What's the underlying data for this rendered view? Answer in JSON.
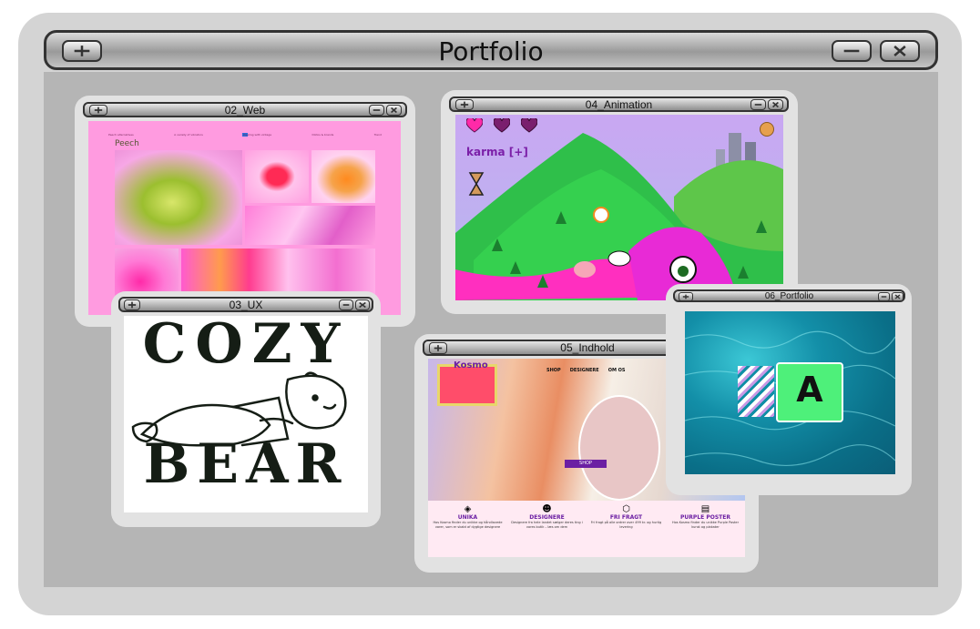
{
  "app": {
    "title": "Portfolio"
  },
  "windows": {
    "web": {
      "title": "02_Web",
      "brand": "Peech",
      "nav": [
        "Peech alternatives",
        "A variety of vibrators",
        "Healing with vintage",
        "Dildos &  brands",
        "Trend"
      ]
    },
    "animation": {
      "title": "04_Animation",
      "counter": "karma [+]"
    },
    "ux": {
      "title": "03_UX",
      "artwork_line1": "COZY",
      "artwork_line2": "BEAR"
    },
    "indhold": {
      "title": "05_Indhold",
      "logo": "Kosmo",
      "nav": [
        "SHOP",
        "DESIGNERE",
        "OM OS"
      ],
      "cta": "SHOP",
      "features": [
        {
          "heading": "UNIKA",
          "text": "Hos Kosmo finder du unikke og håndlavede varer, som er skabt af dygtige designere"
        },
        {
          "heading": "DESIGNERE",
          "text": "Designere fra hele landet sælger deres ting i vores butik – læs om dem"
        },
        {
          "heading": "FRI FRAGT",
          "text": "Fri fragt på alle ordrer over 499 kr. og hurtig levering"
        },
        {
          "heading": "PURPLE POSTER",
          "text": "Hos Kosmo finder du unikke Purple Poster kunst og plakater"
        }
      ]
    },
    "portfolio": {
      "title": "06_Portfolio",
      "logo_letter": "A"
    }
  },
  "colors": {
    "frame": "#d4d4d4",
    "desk": "#b5b5b5",
    "web_bg": "#ff9be0",
    "ux_bg": "#ffffff",
    "ocean": "#0f8ea6",
    "purple_accent": "#6b1fa3",
    "logo_green": "#4ef07a"
  }
}
